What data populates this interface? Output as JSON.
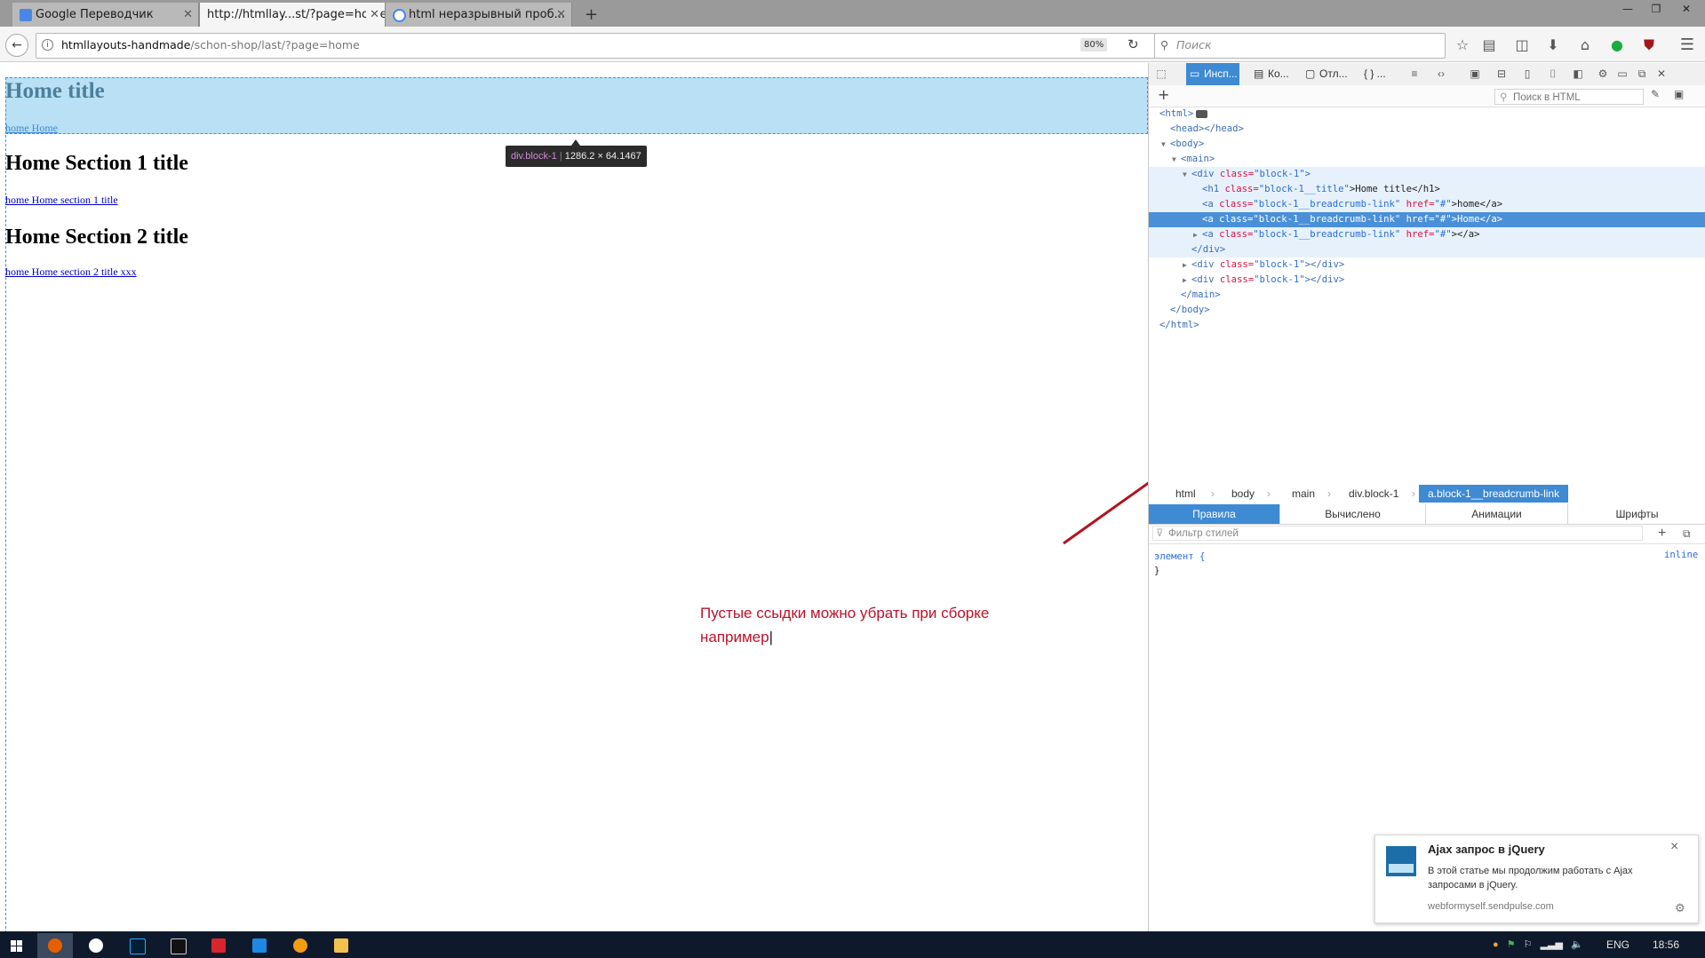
{
  "browser": {
    "tabs": [
      {
        "title": "Google Переводчик",
        "active": false
      },
      {
        "title": "http://htmllay...st/?page=home",
        "active": true
      },
      {
        "title": "html неразрывный проб...",
        "active": false
      }
    ],
    "new_tab": "+",
    "url_host": "htmllayouts-handmade",
    "url_path": "/schon-shop/last/?page=home",
    "zoom": "80%",
    "search_placeholder": "Поиск"
  },
  "page": {
    "home_title": "Home title",
    "home_breadcrumb": "home Home",
    "section1_title": "Home Section 1 title",
    "section1_link": "home Home section 1 title",
    "section2_title": "Home Section 2 title",
    "section2_link": "home Home section 2 title xxx",
    "tooltip_tag": "div.block-1",
    "tooltip_size": "1286.2 × 64.1467",
    "annotation_line1": "Пустые ссыдки можно убрать при сборке",
    "annotation_line2": "например"
  },
  "devtools": {
    "tabs": [
      "Инсп...",
      "Ко...",
      "Отл...",
      "{ } ..."
    ],
    "html_search_placeholder": "Поиск в HTML",
    "markup": {
      "l0_tag": "<html>",
      "l1": "<head></head>",
      "l2": "<body>",
      "l3": "<main>",
      "l4_open": "<div ",
      "l4_attr": "class=",
      "l4_val": "\"block-1\"",
      "l4_close": ">",
      "l5_open": "<h1 ",
      "l5_attr": "class=",
      "l5_val": "\"block-1__title\"",
      "l5_text": ">Home title</h1>",
      "l6_open": "<a ",
      "l6_attr": "class=",
      "l6_val": "\"block-1__breadcrumb-link\"",
      "l6_attr2": " href=",
      "l6_val2": "\"#\"",
      "l6_text": ">home</a>",
      "l7_text": ">Home</a>",
      "l8_text": "></a>",
      "l9": "</div>",
      "l10_text": "></div>",
      "l12": "</main>",
      "l13": "</body>",
      "l14": "</html>"
    },
    "breadcrumbs": [
      "html",
      "body",
      "main",
      "div.block-1",
      "a.block-1__breadcrumb-link"
    ],
    "rules_tabs": [
      "Правила",
      "Вычислено",
      "Анимации",
      "Шрифты"
    ],
    "filter_placeholder": "Фильтр стилей",
    "rule_selector": "элемент {",
    "rule_close": "}",
    "rule_source": "inline"
  },
  "notification": {
    "title": "Ajax запрос в jQuery",
    "body_line1": "В этой статье мы продолжим работать с Ajax",
    "body_line2": "запросами в jQuery.",
    "source": "webformyself.sendpulse.com",
    "close": "×"
  },
  "taskbar": {
    "lang": "ENG",
    "time": "18:56"
  },
  "colors": {
    "highlight_fill": "#b9e0f4",
    "highlight_border": "#2f9bd9",
    "devtools_selected": "#3e8ad3",
    "annotation": "#c0112a",
    "taskbar": "#0e1a2b"
  }
}
